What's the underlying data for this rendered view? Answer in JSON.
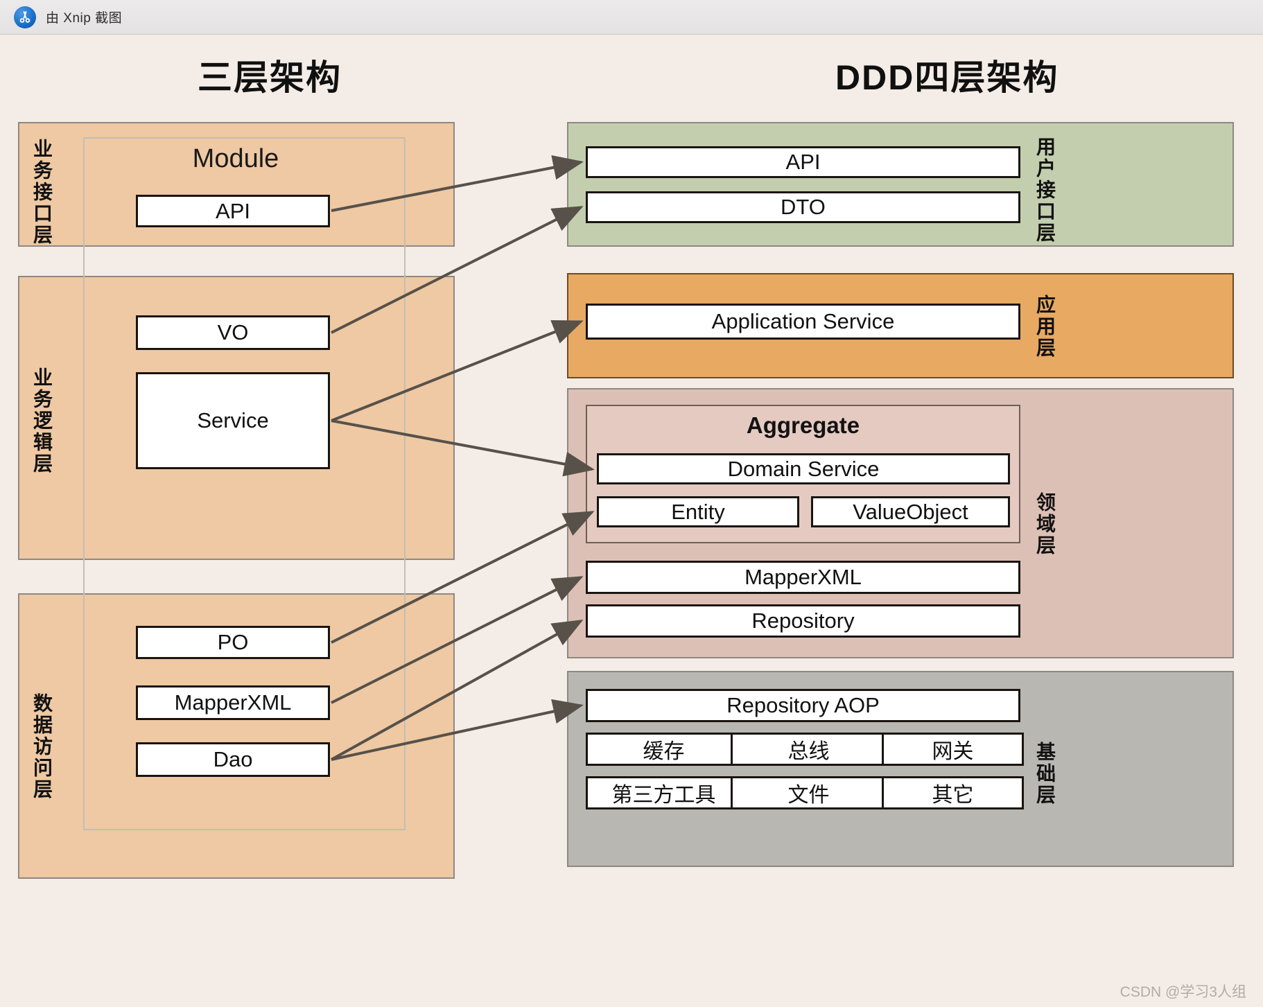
{
  "window": {
    "title": "由 Xnip 截图",
    "icon": "xnip-scissors-icon"
  },
  "headings": {
    "left": "三层架构",
    "right": "DDD四层架构"
  },
  "colors": {
    "canvas_bg": "#f4ece6",
    "three_layer_fill": "#eec9a3",
    "ui_layer_fill": "#c3ceae",
    "app_layer_fill": "#e8a963",
    "domain_layer_fill": "#ddc0b5",
    "aggregate_fill": "#e4cac1",
    "infra_layer_fill": "#b9b7b2",
    "box_border": "#1a1410",
    "arrow": "#57514a"
  },
  "left_architecture": {
    "module_label": "Module",
    "layers": [
      {
        "vertical_label": "业务接口层",
        "boxes": [
          "API"
        ]
      },
      {
        "vertical_label": "业务逻辑层",
        "boxes": [
          "VO",
          "Service"
        ]
      },
      {
        "vertical_label": "数据访问层",
        "boxes": [
          "PO",
          "MapperXML",
          "Dao"
        ]
      }
    ]
  },
  "right_architecture": {
    "layers": [
      {
        "vertical_label": "用户接口层",
        "boxes": [
          "API",
          "DTO"
        ]
      },
      {
        "vertical_label": "应用层",
        "boxes": [
          "Application Service"
        ]
      },
      {
        "vertical_label": "领域层",
        "aggregate_title": "Aggregate",
        "aggregate_boxes": [
          "Domain Service",
          "Entity",
          "ValueObject"
        ],
        "boxes": [
          "MapperXML",
          "Repository"
        ]
      },
      {
        "vertical_label": "基础层",
        "boxes": [
          "Repository AOP",
          "缓存",
          "总线",
          "网关",
          "第三方工具",
          "文件",
          "其它"
        ]
      }
    ]
  },
  "mappings": [
    {
      "from": "API",
      "to": "API"
    },
    {
      "from": "VO",
      "to": "DTO"
    },
    {
      "from": "Service",
      "to": "Application Service"
    },
    {
      "from": "Service",
      "to": "Domain Service"
    },
    {
      "from": "PO",
      "to": "Entity"
    },
    {
      "from": "MapperXML",
      "to": "MapperXML"
    },
    {
      "from": "Dao",
      "to": "Repository"
    },
    {
      "from": "Dao",
      "to": "Repository AOP"
    }
  ],
  "watermark": "CSDN @学习3人组"
}
